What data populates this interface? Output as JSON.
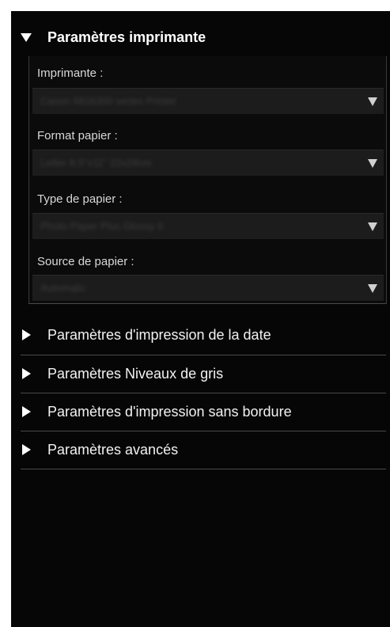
{
  "sections": {
    "printer": {
      "title": "Paramètres imprimante",
      "fields": [
        {
          "label": "Imprimante :",
          "value": "Canon MG6300 series Printer"
        },
        {
          "label": "Format papier :",
          "value": "Letter 8.5\"x11\" 22x28cm"
        },
        {
          "label": "Type de papier :",
          "value": "Photo Paper Plus Glossy II"
        },
        {
          "label": "Source de papier :",
          "value": "Automatic"
        }
      ]
    },
    "collapsed": [
      {
        "title": "Paramètres d'impression de la date"
      },
      {
        "title": "Paramètres Niveaux de gris"
      },
      {
        "title": "Paramètres d'impression sans bordure"
      },
      {
        "title": "Paramètres avancés"
      }
    ]
  },
  "colors": {
    "panel_bg": "#060606",
    "text": "#ffffff",
    "dropdown_bg": "#1c1c1c"
  },
  "icons": {
    "expanded": "triangle-down-icon",
    "collapsed": "triangle-right-icon",
    "dropdown": "dropdown-arrow-icon"
  }
}
